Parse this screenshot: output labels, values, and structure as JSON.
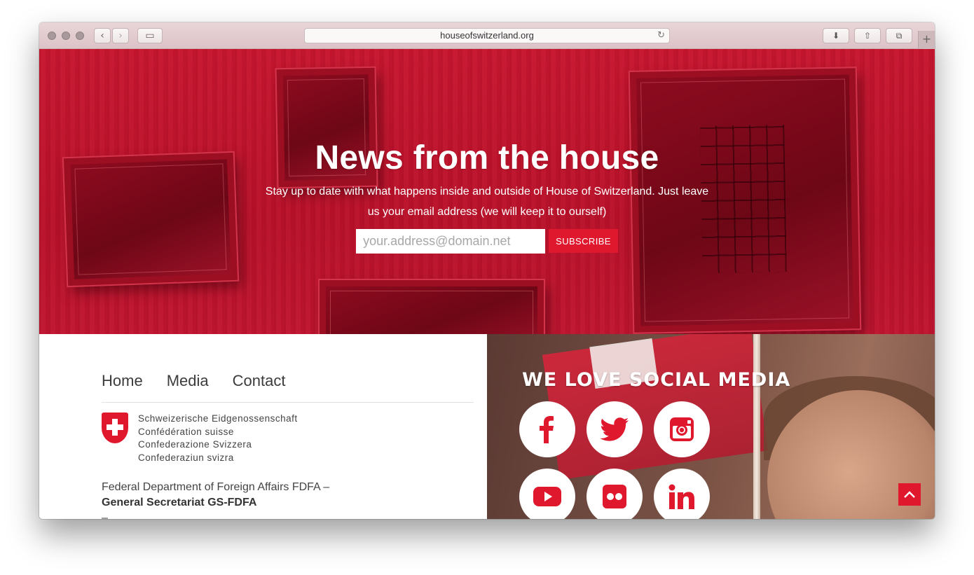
{
  "browser": {
    "url": "houseofswitzerland.org"
  },
  "hero": {
    "title": "News from the house",
    "subtitle": "Stay up to date with what happens inside and outside of House of Switzerland. Just leave us your email address (we will keep it to ourself)",
    "email_placeholder": "your.address@domain.net",
    "subscribe_label": "SUBSCRIBE"
  },
  "footer": {
    "nav": [
      "Home",
      "Media",
      "Contact"
    ],
    "gov_lines": [
      "Schweizerische Eidgenossenschaft",
      "Confédération suisse",
      "Confederazione Svizzera",
      "Confederaziun svizra"
    ],
    "dept_line1": "Federal Department of Foreign Affairs FDFA –",
    "dept_line2": "General Secretariat GS-FDFA",
    "cutoff_text": "–"
  },
  "social": {
    "title": "WE LOVE SOCIAL MEDIA",
    "icons": [
      "facebook-icon",
      "twitter-icon",
      "instagram-icon",
      "youtube-icon",
      "flickr-icon",
      "linkedin-icon"
    ]
  },
  "colors": {
    "brand_red": "#e0182e",
    "hero_red": "#c01530"
  }
}
